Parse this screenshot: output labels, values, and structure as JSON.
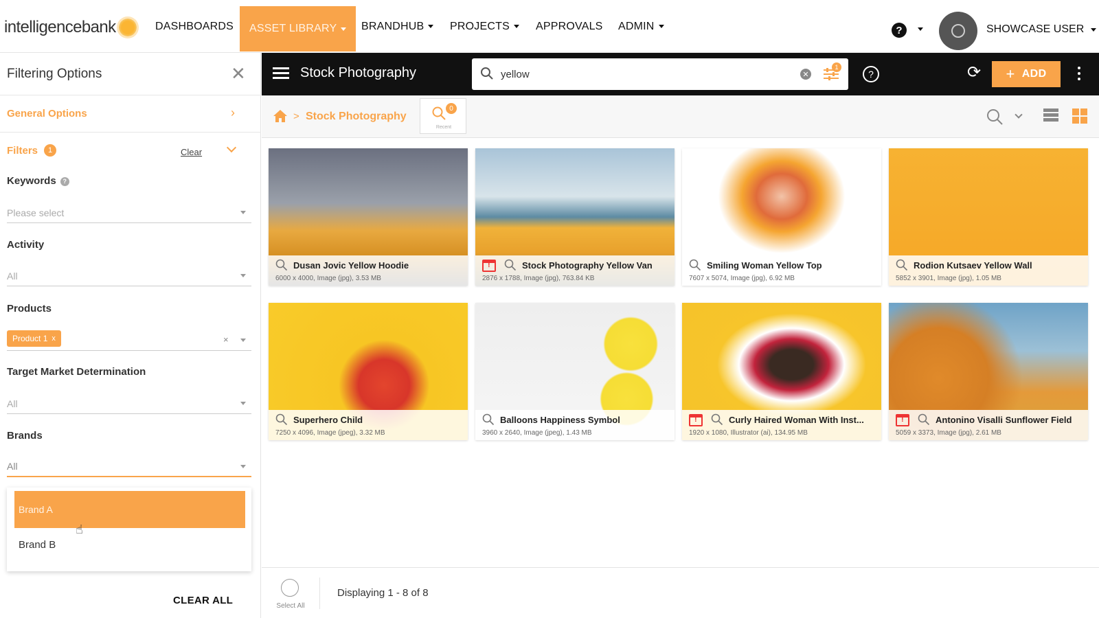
{
  "app": {
    "logo_text": "intelligencebank"
  },
  "nav": {
    "items": [
      {
        "label": "DASHBOARDS"
      },
      {
        "label": "ASSET LIBRARY"
      },
      {
        "label": "BRANDHUB"
      },
      {
        "label": "PROJECTS"
      },
      {
        "label": "APPROVALS"
      },
      {
        "label": "ADMIN"
      }
    ],
    "help": "?",
    "user": "SHOWCASE USER"
  },
  "filter_panel": {
    "title": "Filtering Options",
    "close": "✕",
    "general": "General Options",
    "filters": "Filters",
    "filters_count": "1",
    "clear": "Clear",
    "keywords": {
      "label": "Keywords",
      "placeholder": "Please select"
    },
    "activity": {
      "label": "Activity",
      "value": "All"
    },
    "products": {
      "label": "Products",
      "tag": "Product 1",
      "tag_x": "x",
      "clear": "×"
    },
    "target_market": {
      "label": "Target Market Determination",
      "value": "All"
    },
    "brands": {
      "label": "Brands",
      "value": "All",
      "options": [
        "Brand A",
        "Brand B"
      ]
    },
    "clear_all": "CLEAR ALL"
  },
  "toolbar": {
    "title": "Stock Photography",
    "search_value": "yellow",
    "filter_badge": "1",
    "help": "?",
    "add": "ADD",
    "add_plus": "+"
  },
  "breadcrumb": {
    "sep": ">",
    "label": "Stock Photography",
    "saved_badge": "0",
    "saved_caption": "Recent"
  },
  "assets": [
    {
      "title": "Dusan Jovic Yellow Hoodie",
      "info": "6000 x 4000, Image (jpg), 3.53 MB"
    },
    {
      "title": "Stock Photography Yellow Van",
      "info": "2876 x 1788, Image (jpg), 763.84 KB"
    },
    {
      "title": "Smiling Woman Yellow Top",
      "info": "7607 x 5074, Image (jpg), 6.92 MB"
    },
    {
      "title": "Rodion Kutsaev Yellow Wall",
      "info": "5852 x 3901, Image (jpg), 1.05 MB"
    },
    {
      "title": "Superhero Child",
      "info": "7250 x 4096, Image (jpeg), 3.32 MB"
    },
    {
      "title": "Balloons Happiness Symbol",
      "info": "3960 x 2640, Image (jpeg), 1.43 MB"
    },
    {
      "title": "Curly Haired Woman With Inst...",
      "info": "1920 x 1080, Illustrator (ai), 134.95 MB"
    },
    {
      "title": "Antonino Visalli Sunflower Field",
      "info": "5059 x 3373, Image (jpg), 2.61 MB"
    }
  ],
  "footer": {
    "select_all": "Select All",
    "display": "Displaying 1 - 8 of 8"
  },
  "colors": {
    "accent": "#f9a44a",
    "toolbar_bg": "#111111"
  }
}
